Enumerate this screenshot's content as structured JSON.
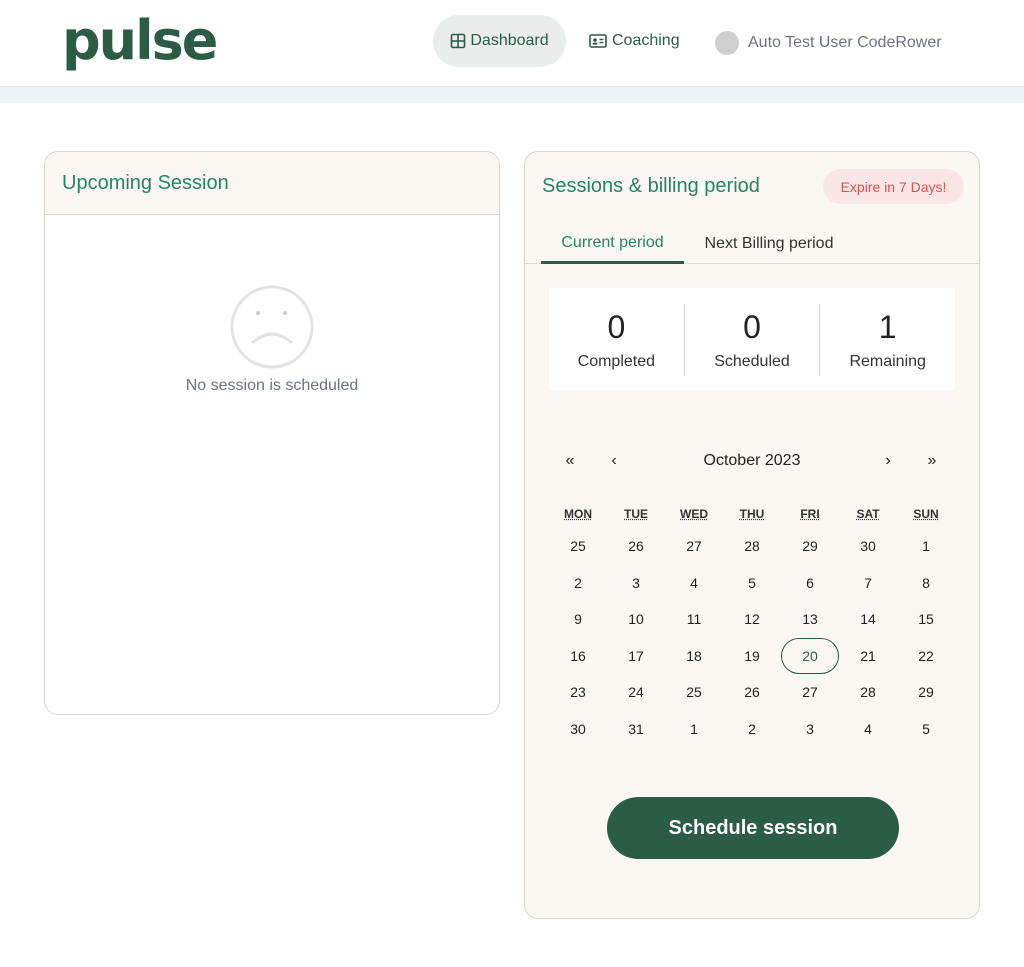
{
  "brand": {
    "logo_text": "pulse",
    "color": "#2b5c45"
  },
  "nav": {
    "dashboard_label": "Dashboard",
    "coaching_label": "Coaching",
    "user_name": "Auto Test User CodeRower"
  },
  "upcoming": {
    "title": "Upcoming Session",
    "empty_text": "No session is scheduled"
  },
  "billing": {
    "title": "Sessions & billing period",
    "badge": "Expire in 7 Days!",
    "tabs": [
      {
        "label": "Current period",
        "active": true
      },
      {
        "label": "Next Billing period",
        "active": false
      }
    ],
    "stats": [
      {
        "value": "0",
        "label": "Completed"
      },
      {
        "value": "0",
        "label": "Scheduled"
      },
      {
        "value": "1",
        "label": "Remaining"
      }
    ]
  },
  "calendar": {
    "month_label": "October 2023",
    "nav": {
      "prev_year": "«",
      "prev_month": "‹",
      "next_month": "›",
      "next_year": "»"
    },
    "weekdays": [
      "MON",
      "TUE",
      "WED",
      "THU",
      "FRI",
      "SAT",
      "SUN"
    ],
    "weeks": [
      [
        "25",
        "26",
        "27",
        "28",
        "29",
        "30",
        "1"
      ],
      [
        "2",
        "3",
        "4",
        "5",
        "6",
        "7",
        "8"
      ],
      [
        "9",
        "10",
        "11",
        "12",
        "13",
        "14",
        "15"
      ],
      [
        "16",
        "17",
        "18",
        "19",
        "20",
        "21",
        "22"
      ],
      [
        "23",
        "24",
        "25",
        "26",
        "27",
        "28",
        "29"
      ],
      [
        "30",
        "31",
        "1",
        "2",
        "3",
        "4",
        "5"
      ]
    ],
    "today": "20"
  },
  "schedule_button_label": "Schedule session",
  "colors": {
    "accent": "#24875c",
    "primary": "#2b5c45",
    "badge_text": "#d9534f",
    "badge_bg": "#fbe6e6"
  }
}
